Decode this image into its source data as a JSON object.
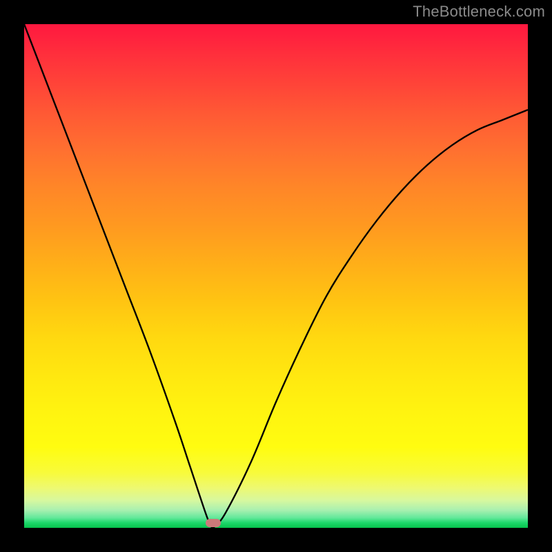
{
  "watermark": "TheBottleneck.com",
  "marker": {
    "x_pct": 37.5,
    "y_pct": 99.0
  },
  "colors": {
    "frame": "#000000",
    "curve_stroke": "#000000",
    "watermark_text": "#8a8a8a",
    "marker_fill": "#cc7a7a"
  },
  "chart_data": {
    "type": "line",
    "title": "",
    "xlabel": "",
    "ylabel": "",
    "xlim": [
      0,
      100
    ],
    "ylim": [
      0,
      100
    ],
    "note": "y is a relative metric: 0 at minimum near x≈37, rising toward 100 at both extremes",
    "series": [
      {
        "name": "curve",
        "x": [
          0,
          5,
          10,
          15,
          20,
          25,
          30,
          33,
          36,
          37,
          37.5,
          38,
          40,
          45,
          50,
          55,
          60,
          65,
          70,
          75,
          80,
          85,
          90,
          95,
          100
        ],
        "values": [
          100,
          87,
          74,
          61,
          48,
          35,
          21,
          12,
          3,
          0.5,
          0,
          0.5,
          3,
          13,
          25,
          36,
          46,
          54,
          61,
          67,
          72,
          76,
          79,
          81,
          83
        ]
      }
    ],
    "minimum_point": {
      "x": 37.5,
      "y": 0
    }
  }
}
